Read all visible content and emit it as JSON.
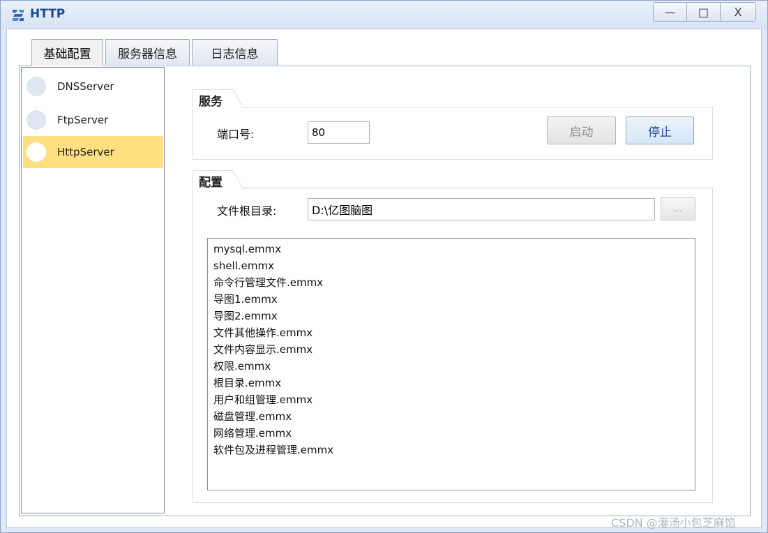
{
  "window": {
    "title": "HTTP",
    "controls": {
      "minimize": "—",
      "maximize": "□",
      "close": "X"
    }
  },
  "tabs": [
    {
      "label": "基础配置",
      "active": true
    },
    {
      "label": "服务器信息",
      "active": false
    },
    {
      "label": "日志信息",
      "active": false
    }
  ],
  "servers": [
    {
      "label": "DNSServer",
      "selected": false
    },
    {
      "label": "FtpServer",
      "selected": false
    },
    {
      "label": "HttpServer",
      "selected": true
    }
  ],
  "service": {
    "group_title": "服务",
    "port_label": "端口号:",
    "port_value": "80",
    "start_label": "启动",
    "stop_label": "停止"
  },
  "config": {
    "group_title": "配置",
    "root_label": "文件根目录:",
    "root_value": "D:\\亿图脑图",
    "browse_label": "...",
    "files": [
      "mysql.emmx",
      "shell.emmx",
      "命令行管理文件.emmx",
      "导图1.emmx",
      "导图2.emmx",
      "文件其他操作.emmx",
      "文件内容显示.emmx",
      "权限.emmx",
      "根目录.emmx",
      "用户和组管理.emmx",
      "磁盘管理.emmx",
      "网络管理.emmx",
      "软件包及进程管理.emmx"
    ]
  },
  "watermark": "CSDN @灌汤小包芝麻馅",
  "colors": {
    "selected_bg": "#ffe080",
    "title_color": "#1b4d8c",
    "frame_bg": "#dfe8f6"
  }
}
